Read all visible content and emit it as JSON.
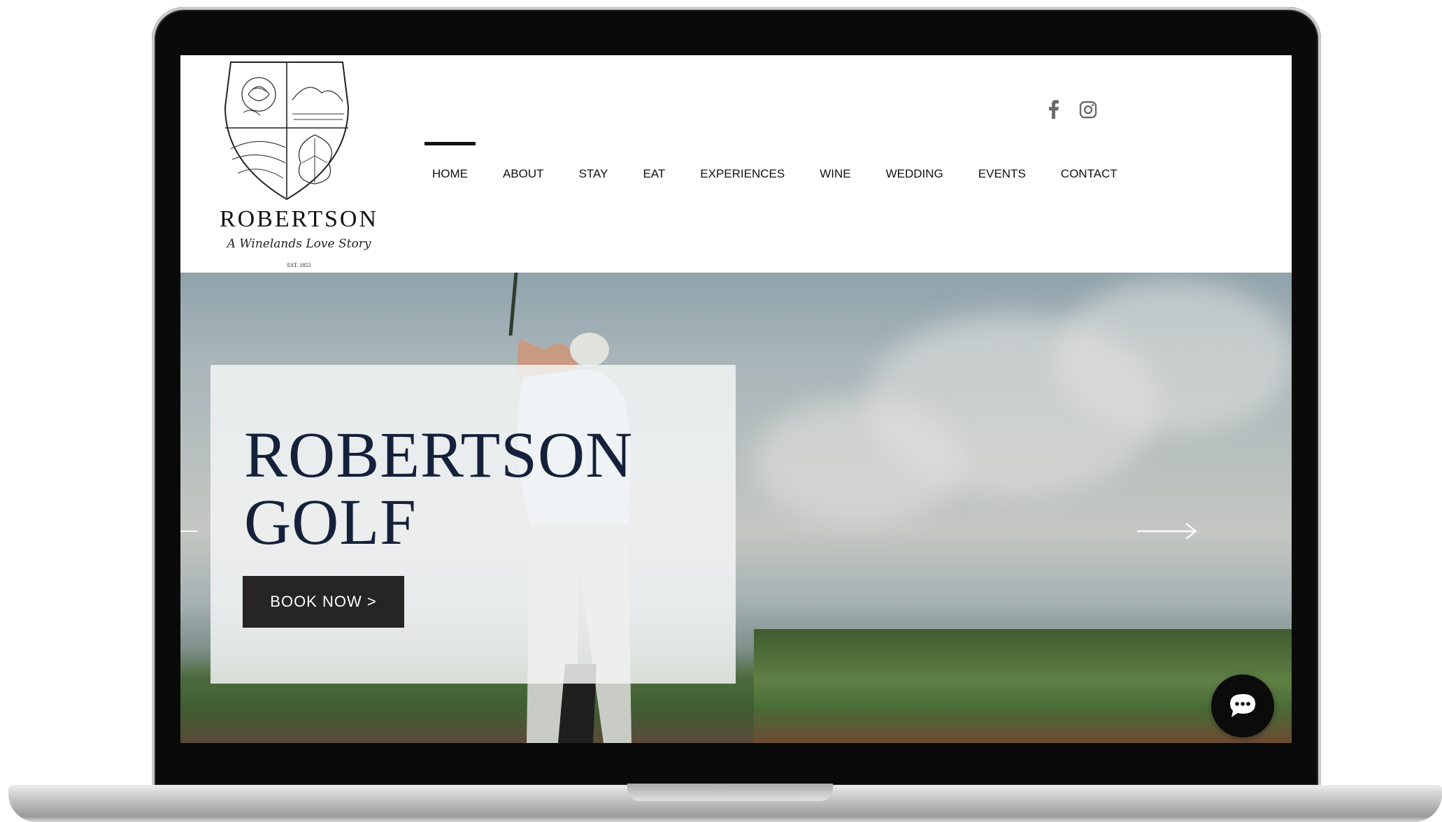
{
  "brand": {
    "name": "ROBERTSON",
    "tagline": "A Winelands Love Story",
    "established": "EST. 1853"
  },
  "nav": {
    "items": [
      {
        "label": "HOME",
        "active": true
      },
      {
        "label": "ABOUT"
      },
      {
        "label": "STAY"
      },
      {
        "label": "EAT"
      },
      {
        "label": "EXPERIENCES"
      },
      {
        "label": "WINE"
      },
      {
        "label": "WEDDING"
      },
      {
        "label": "EVENTS"
      },
      {
        "label": "CONTACT"
      }
    ]
  },
  "social": {
    "icons": [
      "facebook-icon",
      "instagram-icon"
    ],
    "color": "#6b6b6b"
  },
  "hero": {
    "title_line1": "ROBERTSON",
    "title_line2": "GOLF",
    "button_label": "BOOK NOW >",
    "title_color": "#15213b",
    "button_color": "#262424"
  },
  "chat": {
    "icon": "chat-bubble-icon"
  }
}
